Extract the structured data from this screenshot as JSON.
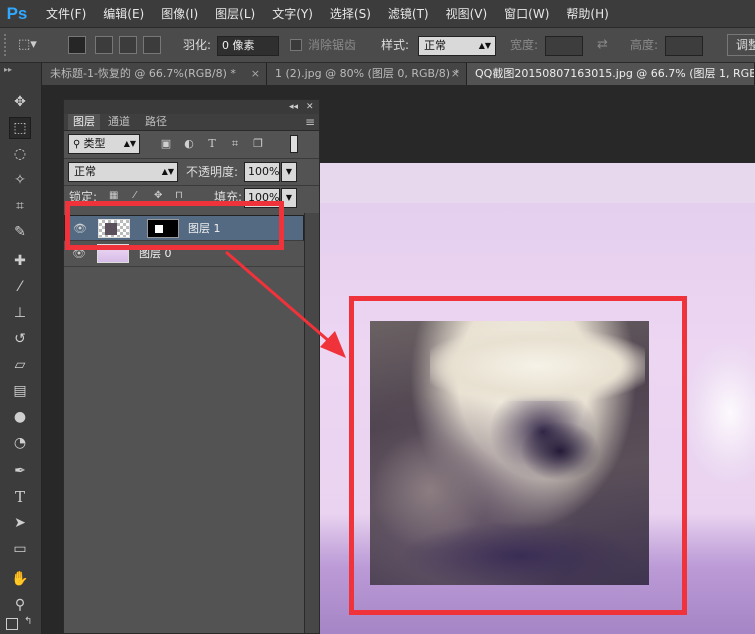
{
  "app": {
    "logo": "Ps"
  },
  "menu": [
    "文件(F)",
    "编辑(E)",
    "图像(I)",
    "图层(L)",
    "文字(Y)",
    "选择(S)",
    "滤镜(T)",
    "视图(V)",
    "窗口(W)",
    "帮助(H)"
  ],
  "options": {
    "feather_label": "羽化:",
    "feather_value": "0 像素",
    "antialias_label": "消除锯齿",
    "style_label": "样式:",
    "style_value": "正常",
    "width_label": "宽度:",
    "height_label": "高度:",
    "adjust_label": "调整"
  },
  "tabs": [
    {
      "label": "未标题-1-恢复的 @ 66.7%(RGB/8) *",
      "close": "×"
    },
    {
      "label": "1 (2).jpg @ 80% (图层 0, RGB/8) *",
      "close": "×"
    },
    {
      "label": "QQ截图20150807163015.jpg @ 66.7% (图层 1, RGB/8)",
      "close": ""
    }
  ],
  "layers_panel": {
    "collapse": "◂◂",
    "close": "✕",
    "tabs": [
      "图层",
      "通道",
      "路径"
    ],
    "menu_icon": "≡",
    "filter_value": "类型",
    "blend_mode": "正常",
    "opacity_label": "不透明度:",
    "opacity_value": "100%",
    "lock_label": "锁定:",
    "fill_label": "填充:",
    "fill_value": "100%",
    "layers": [
      {
        "name": "图层 1",
        "selected": true
      },
      {
        "name": "图层 0",
        "selected": false
      }
    ]
  },
  "colors": {
    "highlight": "#f0323a",
    "selected_layer": "#536a82",
    "ps_blue": "#31a8ff"
  }
}
